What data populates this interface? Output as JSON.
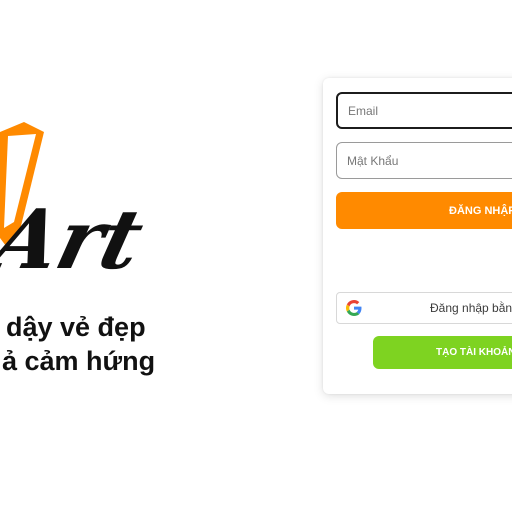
{
  "brand": {
    "logo_text": "Art",
    "tagline_line1": "dậy vẻ đẹp",
    "tagline_line2": "ả cảm hứng",
    "accent_color": "#ff8a00"
  },
  "login_form": {
    "email_placeholder": "Email",
    "password_placeholder": "Mật Khẩu",
    "login_button_label": "ĐĂNG NHẬP",
    "google_button_label": "Đăng nhập bằng",
    "google_icon": "google-icon",
    "create_account_label": "TẠO TÀI KHOẢN M",
    "login_button_color": "#ff8a00",
    "create_button_color": "#7ed321"
  }
}
